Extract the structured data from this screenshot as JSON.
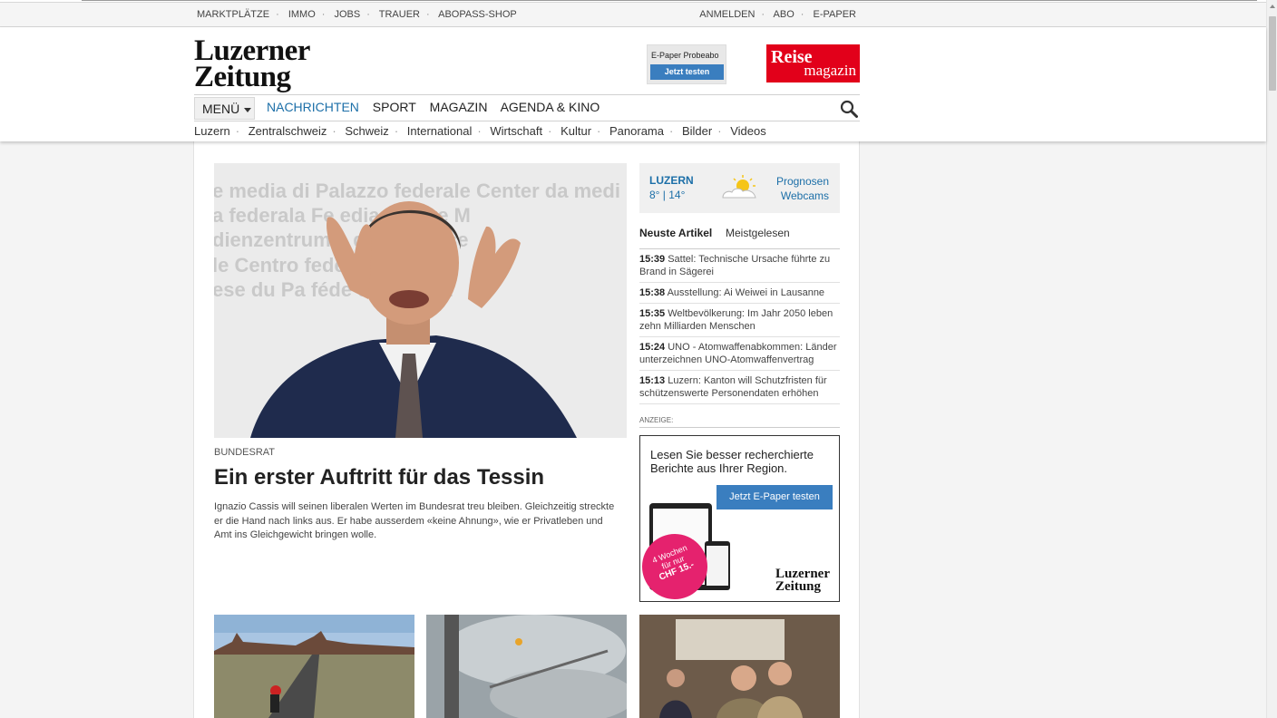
{
  "utility": {
    "left": [
      "MARKTPLÄTZE",
      "IMMO",
      "JOBS",
      "TRAUER",
      "ABOPASS-SHOP"
    ],
    "right": [
      "ANMELDEN",
      "ABO",
      "E-PAPER"
    ]
  },
  "header": {
    "logo_line1": "Luzerner",
    "logo_line2": "Zeitung",
    "epaper_ad": {
      "title": "E-Paper Probeabo",
      "button": "Jetzt testen"
    },
    "reise_ad": {
      "line1": "Reise",
      "line2": "magazin"
    }
  },
  "nav": {
    "menu_label": "MENÜ",
    "items": [
      "NACHRICHTEN",
      "SPORT",
      "MAGAZIN",
      "AGENDA & KINO"
    ],
    "active": "NACHRICHTEN"
  },
  "subnav": [
    "Luzern",
    "Zentralschweiz",
    "Schweiz",
    "International",
    "Wirtschaft",
    "Kultur",
    "Panorama",
    "Bilder",
    "Videos"
  ],
  "hero": {
    "kicker": "BUNDESRAT",
    "headline": "Ein erster Auftritt für das Tessin",
    "lead": "Ignazio Cassis will seinen liberalen Werten im Bundesrat treu bleiben. Gleichzeitig streckte er die Hand nach links aus. Er habe ausserdem «keine Ahnung», wie er Privatleben und Amt ins Gleichgewicht bringen wolle.",
    "image_bg_text": [
      "e media di Palazzo federale  Center da medi",
      "a federala  Fe           edia Centre  M",
      "dienzentrum               e de la presse",
      "le  Centro                    federala",
      "ese du Pa   féde              del Palazz"
    ]
  },
  "weather": {
    "city": "LUZERN",
    "temp": "8° | 14°",
    "links": [
      "Prognosen",
      "Webcams"
    ]
  },
  "tabs": [
    "Neuste Artikel",
    "Meistgelesen"
  ],
  "news": [
    {
      "time": "15:39",
      "text": "Sattel: Technische Ursache führte zu Brand in Sägerei"
    },
    {
      "time": "15:38",
      "text": "Ausstellung: Ai Weiwei in Lausanne"
    },
    {
      "time": "15:35",
      "text": "Weltbevölkerung: Im Jahr 2050 leben zehn Milliarden Menschen"
    },
    {
      "time": "15:24",
      "text": "UNO - Atomwaffenabkommen: Länder unterzeichnen UNO-Atomwaffenvertrag"
    },
    {
      "time": "15:13",
      "text": "Luzern: Kanton will Schutzfristen für schützenswerte Personendaten erhöhen"
    }
  ],
  "ad": {
    "label": "ANZEIGE:",
    "text": "Lesen Sie besser recherchierte Berichte aus Ihrer Region.",
    "button": "Jetzt E-Paper testen",
    "badge_line1": "4 Wochen",
    "badge_line2": "für nur",
    "badge_line3": "CHF 15.-",
    "logo_line1": "Luzerner",
    "logo_line2": "Zeitung"
  },
  "colors": {
    "accent": "#1c6fa8",
    "button": "#3a7ebf",
    "reise": "#e2001a",
    "badge": "#e5226e"
  }
}
